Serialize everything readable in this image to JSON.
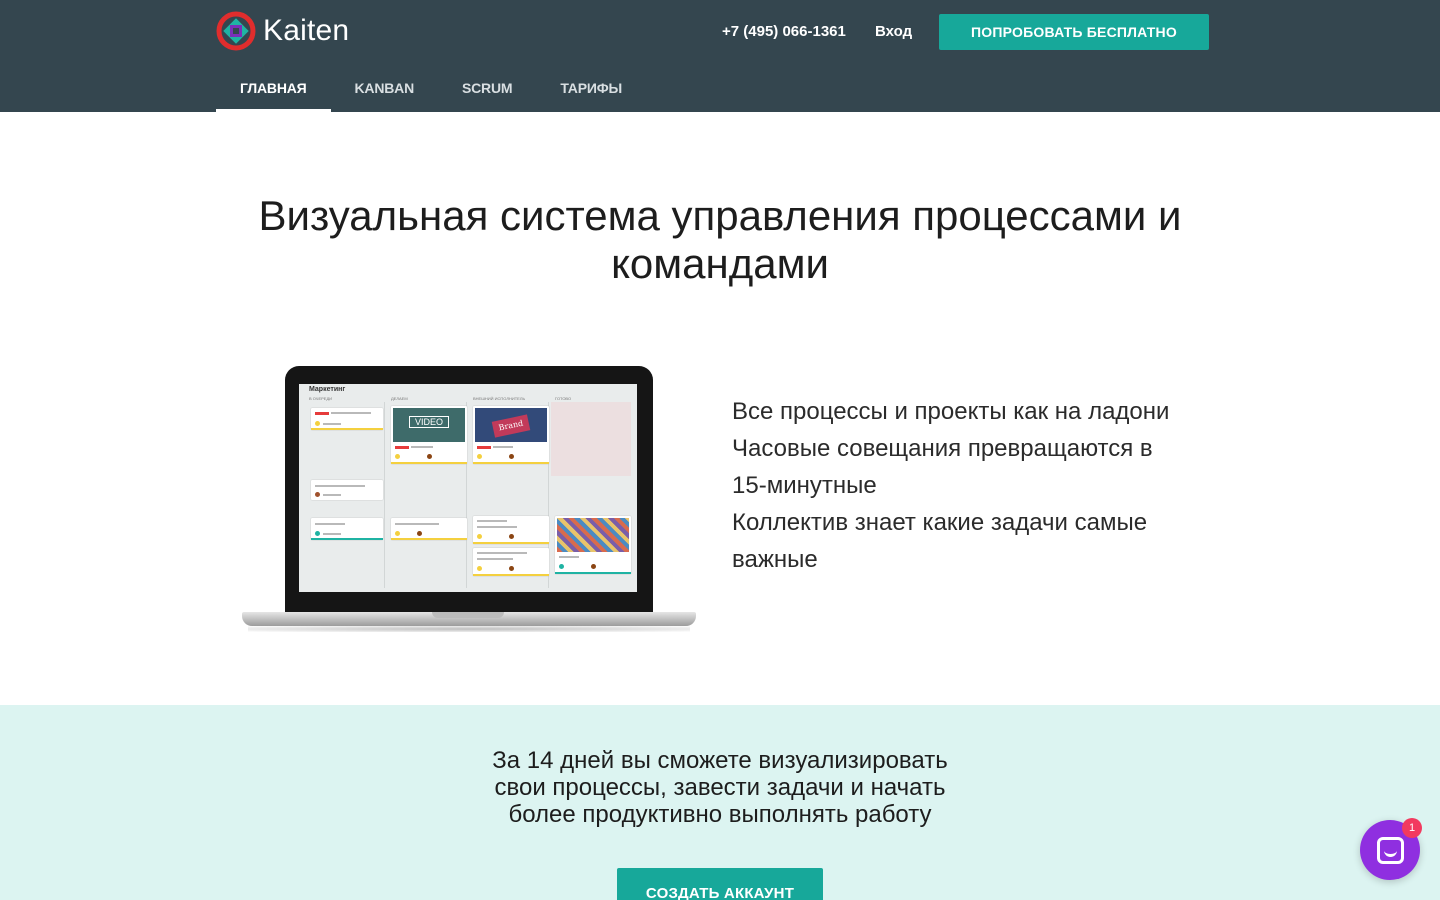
{
  "header": {
    "logo_text": "Kaiten",
    "phone": "+7 (495) 066-1361",
    "login_label": "Вход",
    "try_free_label": "ПОПРОБОВАТЬ БЕСПЛАТНО",
    "nav": [
      {
        "label": "ГЛАВНАЯ",
        "active": true
      },
      {
        "label": "KANBAN",
        "active": false
      },
      {
        "label": "SCRUM",
        "active": false
      },
      {
        "label": "ТАРИФЫ",
        "active": false
      }
    ]
  },
  "hero": {
    "title_line1": "Визуальная система управления процессами и",
    "title_line2": "командами",
    "benefits_line1": "Все процессы и проекты как на ладони",
    "benefits_line2": "Часовые совещания превращаются в",
    "benefits_line3": "15-минутные",
    "benefits_line4": "Коллектив знает какие задачи самые",
    "benefits_line5": "важные"
  },
  "laptop_screen": {
    "board_title": "Маркетинг",
    "columns": [
      "В очереди",
      "Делаем",
      "Внешний исполнитель",
      "Готово"
    ],
    "card_image_video": "VIDEO",
    "card_image_brand": "Brand"
  },
  "cta": {
    "line1": "За 14 дней вы сможете визуализировать",
    "line2": "свои процессы, завести задачи и начать",
    "line3": "более продуктивно выполнять работу",
    "button_label": "СОЗДАТЬ АККАУНТ"
  },
  "chat": {
    "badge_count": "1"
  },
  "colors": {
    "header_bg": "#34464f",
    "accent": "#17a89a",
    "cta_bg": "#dcf4f1",
    "chat": "#8f2fe0",
    "badge": "#f23a5f"
  }
}
